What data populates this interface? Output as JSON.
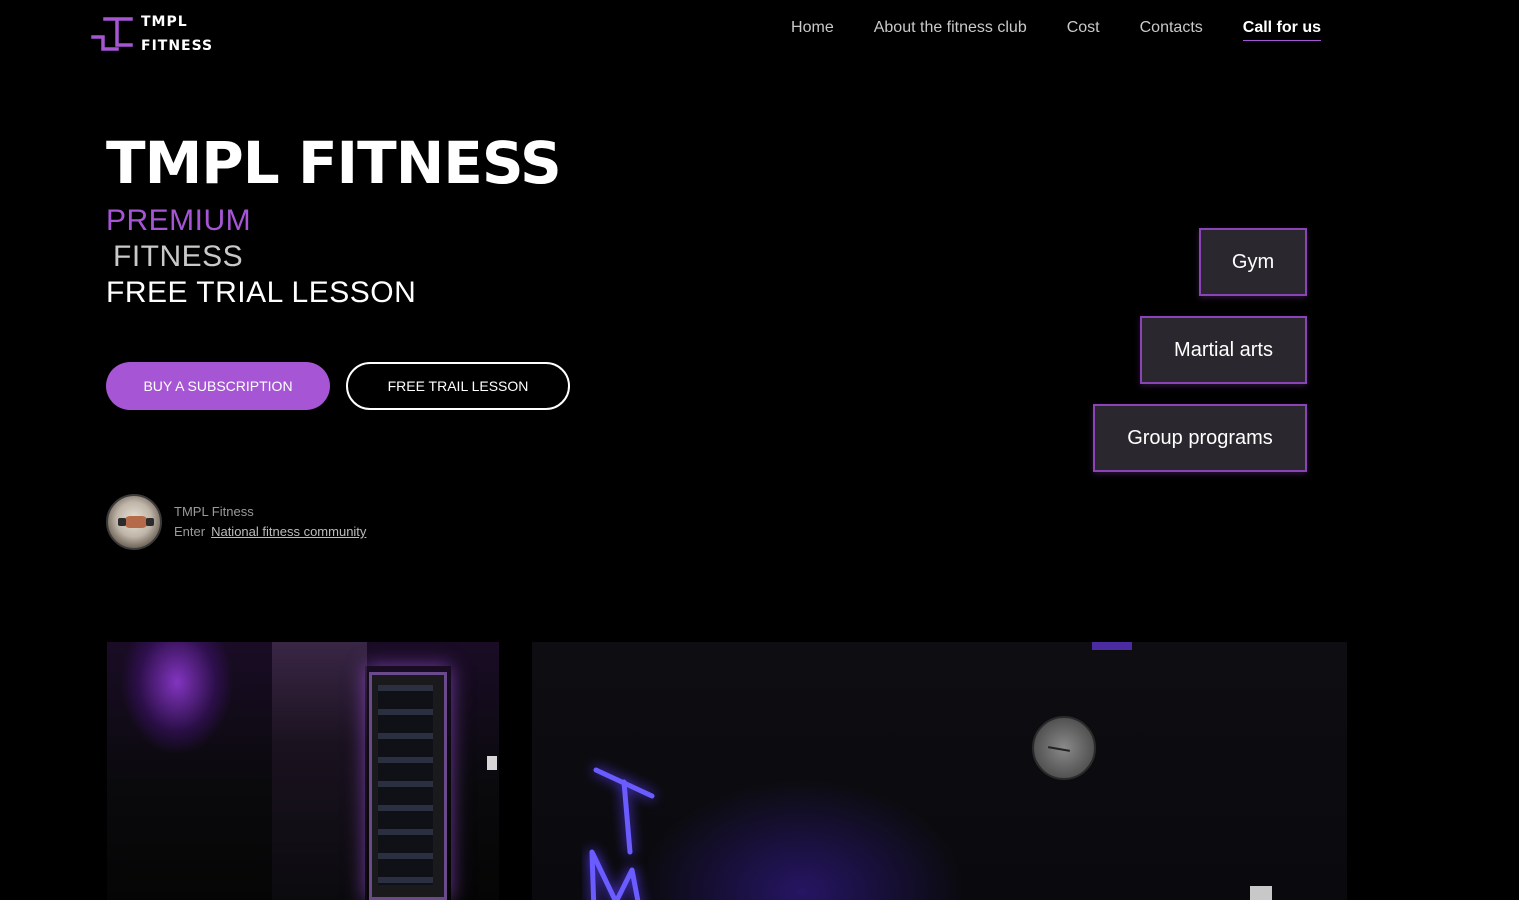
{
  "header": {
    "logo": {
      "line1": "TMPL",
      "line2": "FITNESS"
    },
    "nav": [
      {
        "label": "Home"
      },
      {
        "label": "About the fitness club"
      },
      {
        "label": "Cost"
      },
      {
        "label": "Contacts"
      },
      {
        "label": "Call for us"
      }
    ]
  },
  "hero": {
    "title": "TMPL FITNESS",
    "subtitle1": "PREMIUM",
    "subtitle2": "FITNESS",
    "subtitle3": "FREE TRIAL LESSON",
    "buy_label": "BUY A SUBSCRIPTION",
    "trial_label": "FREE TRAIL LESSON"
  },
  "categories": [
    {
      "label": "Gym"
    },
    {
      "label": "Martial arts"
    },
    {
      "label": "Group programs"
    }
  ],
  "community": {
    "name": "TMPL Fitness",
    "enter": "Enter",
    "link": "National fitness community"
  },
  "colors": {
    "accent": "#a656d4",
    "pill_bg": "#2a282e",
    "background": "#000000"
  }
}
